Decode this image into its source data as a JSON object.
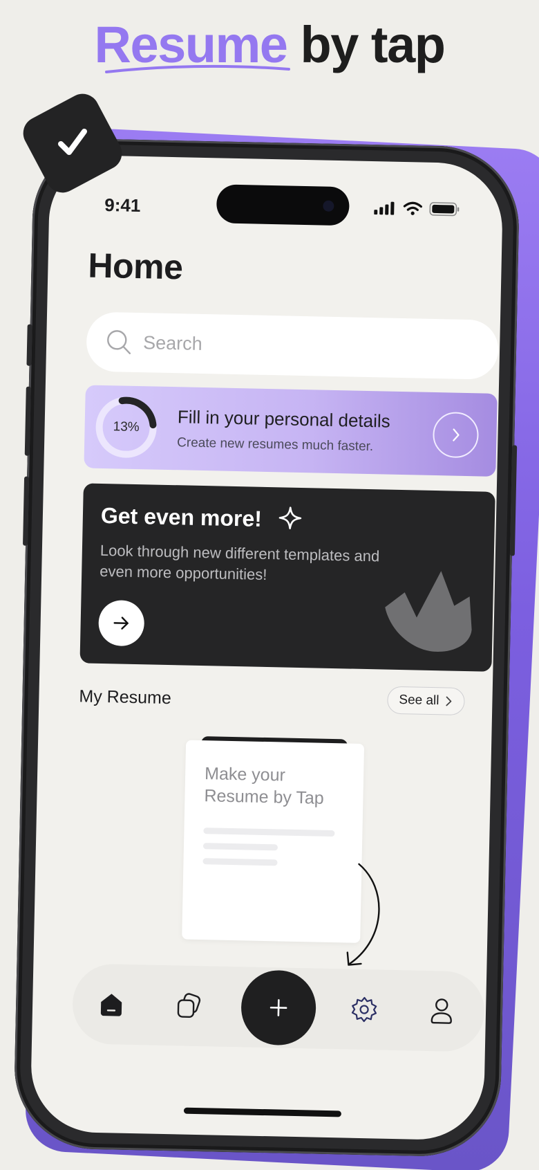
{
  "headline": {
    "accent": "Resume",
    "rest": "by tap"
  },
  "status_bar": {
    "time": "9:41",
    "icons": [
      "signal-icon",
      "wifi-icon",
      "battery-icon"
    ]
  },
  "page": {
    "title": "Home"
  },
  "search": {
    "placeholder": "Search",
    "icon": "search-icon"
  },
  "progress_card": {
    "percent_label": "13%",
    "percent_value": 13,
    "title": "Fill in your personal details",
    "subtitle": "Create new resumes much faster.",
    "icon": "chevron-right-icon"
  },
  "promo_card": {
    "title": "Get even more!",
    "description": "Look through new different templates and even more opportunities!",
    "icons": [
      "sparkle-icon",
      "arrow-right-icon",
      "crown-hand-icon"
    ]
  },
  "my_resume": {
    "section_title": "My Resume",
    "see_all_label": "See all",
    "doc_title": "Make your Resume by Tap"
  },
  "bottom_nav": {
    "items": [
      {
        "name": "home",
        "icon": "home-icon",
        "active": true
      },
      {
        "name": "templates",
        "icon": "copy-icon",
        "active": false
      },
      {
        "name": "add",
        "icon": "plus-icon",
        "active": false
      },
      {
        "name": "settings",
        "icon": "gear-icon",
        "active": false
      },
      {
        "name": "profile",
        "icon": "user-icon",
        "active": false
      }
    ]
  },
  "colors": {
    "accent": "#9478f0",
    "progress_gradient_start": "#d6cafb",
    "progress_gradient_end": "#a58ce1",
    "dark_card": "#252526",
    "screen_bg": "#f2f1ed",
    "settings_icon": "#2b2f64"
  }
}
